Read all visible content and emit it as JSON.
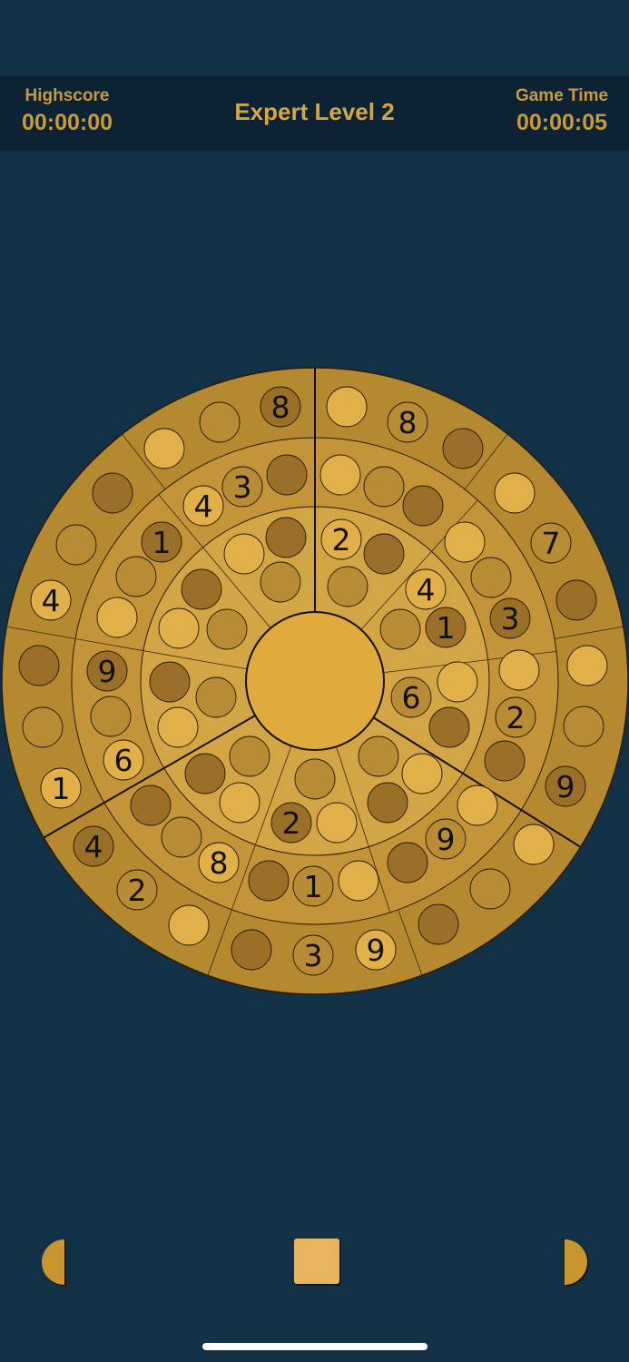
{
  "header": {
    "highscore_label": "Highscore",
    "highscore_value": "00:00:00",
    "title": "Expert Level 2",
    "gametime_label": "Game Time",
    "gametime_value": "00:00:05"
  },
  "board": {
    "given_digits": [
      {
        "slot": 0,
        "digit": "8"
      },
      {
        "slot": 1,
        "digit": "8"
      },
      {
        "slot": 2,
        "digit": "3"
      },
      {
        "slot": 3,
        "digit": "4"
      },
      {
        "slot": 4,
        "digit": "1"
      },
      {
        "slot": 5,
        "digit": "4"
      },
      {
        "slot": 6,
        "digit": "2"
      },
      {
        "slot": 7,
        "digit": "7"
      },
      {
        "slot": 8,
        "digit": "4"
      },
      {
        "slot": 9,
        "digit": "1"
      },
      {
        "slot": 10,
        "digit": "3"
      },
      {
        "slot": 11,
        "digit": "9"
      },
      {
        "slot": 12,
        "digit": "6"
      },
      {
        "slot": 13,
        "digit": "1"
      },
      {
        "slot": 14,
        "digit": "6"
      },
      {
        "slot": 15,
        "digit": "2"
      },
      {
        "slot": 16,
        "digit": "9"
      },
      {
        "slot": 17,
        "digit": "4"
      },
      {
        "slot": 18,
        "digit": "8"
      },
      {
        "slot": 19,
        "digit": "2"
      },
      {
        "slot": 20,
        "digit": "2"
      },
      {
        "slot": 21,
        "digit": "1"
      },
      {
        "slot": 22,
        "digit": "9"
      },
      {
        "slot": 23,
        "digit": "3"
      },
      {
        "slot": 24,
        "digit": "9"
      }
    ]
  },
  "controls": {
    "left_icon": "half-circle-left-icon",
    "center_icon": "square-button-icon",
    "right_icon": "half-circle-right-icon"
  },
  "colors": {
    "background": "#123046",
    "header_bg": "#0d2334",
    "header_text": "#c99a3c",
    "board_outer": "#b48930",
    "board_middle": "#c39538",
    "board_inner": "#d3a645",
    "center": "#e0aa3c",
    "digit": "#111111"
  }
}
